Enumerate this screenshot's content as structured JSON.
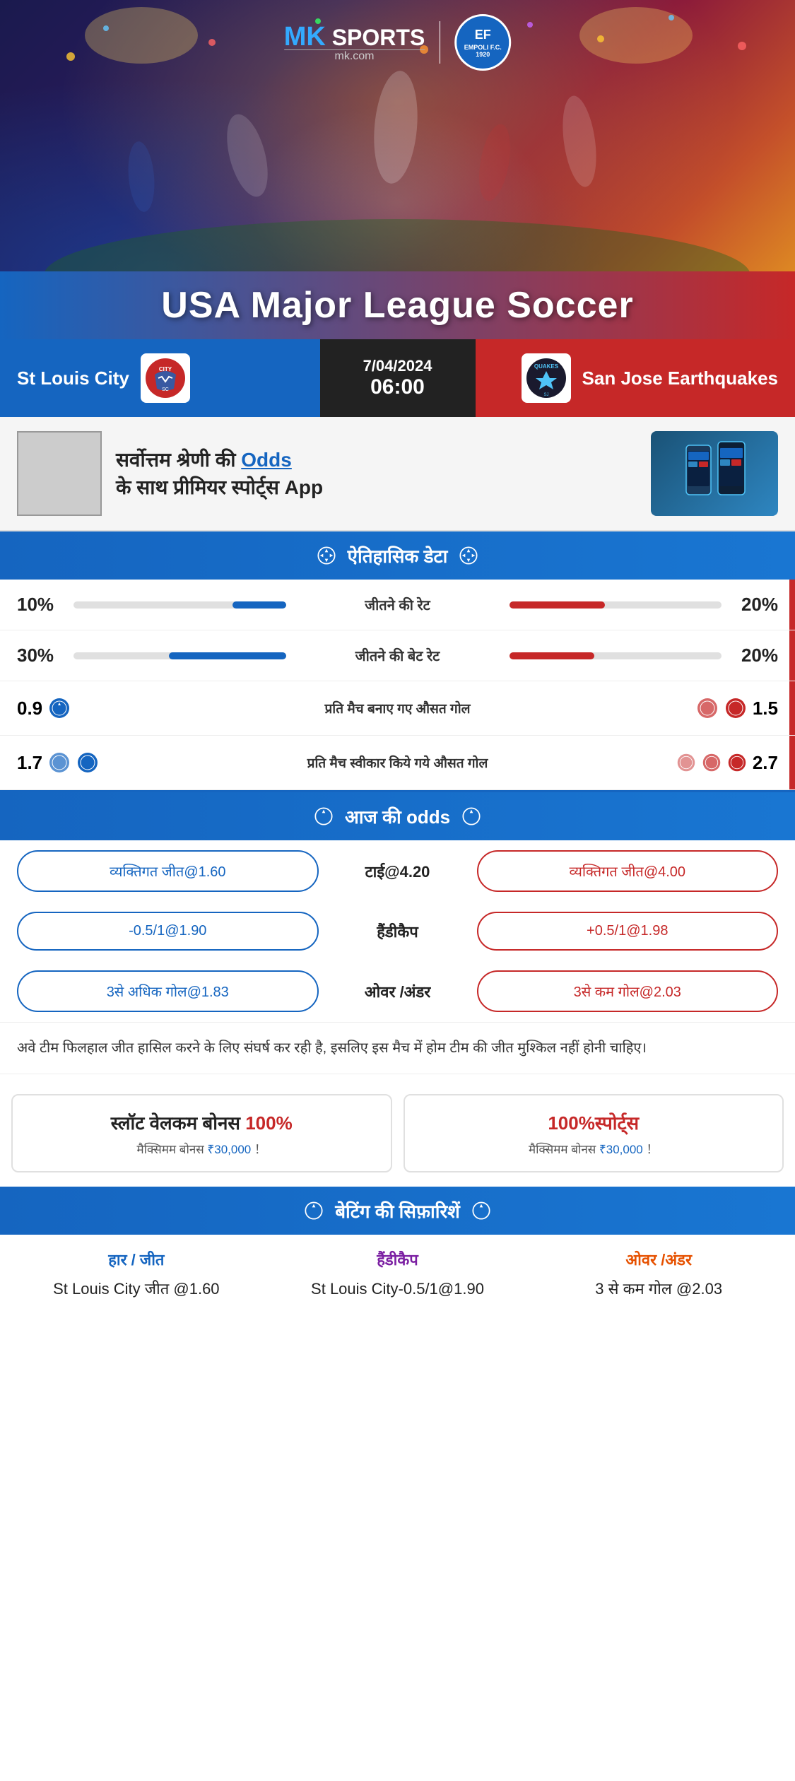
{
  "brand": {
    "name": "MK",
    "sports": "SPORTS",
    "domain": "mk.com",
    "partner": "EMPOLI F.C.",
    "partner_year": "1920"
  },
  "hero": {
    "league": "USA Major League Soccer"
  },
  "match": {
    "home_team": "St Louis City",
    "away_team": "San Jose Earthquakes",
    "away_team_short": "QUAKES",
    "date": "7/04/2024",
    "time": "06:00"
  },
  "promo": {
    "text": "सर्वोत्तम श्रेणी की Odds के साथ प्रीमियर स्पोर्ट्स App",
    "highlight_word": "Odds"
  },
  "sections": {
    "historical": "ऐतिहासिक डेटा",
    "odds": "आज की odds",
    "betting_recs": "बेटिंग की सिफ़ारिशें"
  },
  "stats": [
    {
      "label": "जीतने की रेट",
      "left_val": "10%",
      "right_val": "20%",
      "left_fill": 25,
      "right_fill": 45
    },
    {
      "label": "जीतने की बेट रेट",
      "left_val": "30%",
      "right_val": "20%",
      "left_fill": 55,
      "right_fill": 40
    }
  ],
  "goals_stats": [
    {
      "label": "प्रति मैच बनाए गए औसत गोल",
      "left_val": "0.9",
      "right_val": "1.5",
      "left_balls": 1,
      "right_balls": 2
    },
    {
      "label": "प्रति मैच स्वीकार किये गये औसत गोल",
      "left_val": "1.7",
      "right_val": "2.7",
      "left_balls": 2,
      "right_balls": 3
    }
  ],
  "odds": {
    "home_win": "व्यक्तिगत जीत@1.60",
    "tie": "टाई@4.20",
    "away_win": "व्यक्तिगत जीत@4.00",
    "handicap_home": "-0.5/1@1.90",
    "handicap_label": "हैंडीकैप",
    "handicap_away": "+0.5/1@1.98",
    "over_home": "3से अधिक गोल@1.83",
    "over_label": "ओवर /अंडर",
    "over_away": "3से कम गोल@2.03"
  },
  "analysis": "अवे टीम फिलहाल जीत हासिल करने के लिए संघर्ष कर रही है, इसलिए इस मैच में होम टीम की जीत मुश्किल नहीं होनी चाहिए।",
  "bonus": [
    {
      "title": "स्लॉट वेलकम बोनस 100%",
      "subtitle": "मैक्सिमम बोनस ₹30,000  ！",
      "type": "slot"
    },
    {
      "title": "100%स्पोर्ट्स",
      "subtitle": "मैक्सिमम बोनस  ₹30,000 ！",
      "type": "sports"
    }
  ],
  "betting_recommendations": [
    {
      "type": "हार / जीत",
      "value": "St Louis City जीत @1.60",
      "color": "blue"
    },
    {
      "type": "हैंडीकैप",
      "value": "St Louis City-0.5/1@1.90",
      "color": "purple"
    },
    {
      "type": "ओवर /अंडर",
      "value": "3 से कम गोल @2.03",
      "color": "orange"
    }
  ]
}
